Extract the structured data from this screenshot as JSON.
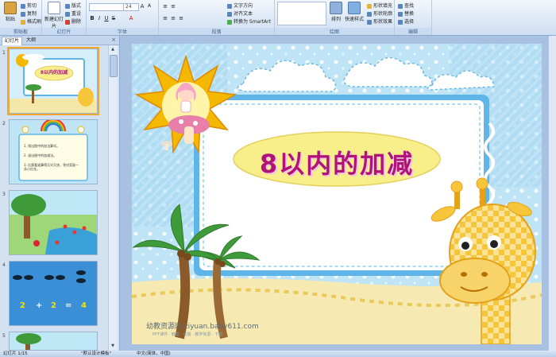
{
  "ribbon": {
    "clipboard": {
      "paste": "粘贴",
      "cut": "剪切",
      "copy": "复制",
      "format_painter": "格式刷",
      "group": "剪贴板"
    },
    "slides": {
      "new_slide": "新建幻灯片",
      "layout": "版式",
      "reset": "重设",
      "delete": "删除",
      "group": "幻灯片"
    },
    "font": {
      "size": "24",
      "group": "字体"
    },
    "paragraph": {
      "text_direction": "文字方向",
      "align_text": "对齐文本",
      "smartart": "转换为 SmartArt",
      "group": "段落"
    },
    "drawing": {
      "arrange": "排列",
      "quick_styles": "快速样式",
      "shape_fill": "形状填充",
      "shape_outline": "形状轮廓",
      "shape_effects": "形状效果",
      "group": "绘图"
    },
    "editing": {
      "find": "查找",
      "replace": "替换",
      "select": "选择",
      "group": "编辑"
    }
  },
  "left_pane": {
    "tabs": [
      "幻灯片",
      "大纲"
    ],
    "close": "×",
    "thumbnails": [
      {
        "number": "1",
        "title": "8以内的加减"
      },
      {
        "number": "2",
        "lines": [
          "1. 找出图中的加法算式。",
          "2. 说出图中的加减法。",
          "3. 比赛看谁算得又对又快，答对奖励一朵小红花。"
        ]
      },
      {
        "number": "3"
      },
      {
        "number": "4",
        "equation": [
          "2",
          "+",
          "2",
          "=",
          "4"
        ]
      },
      {
        "number": "5"
      }
    ]
  },
  "slide": {
    "title": "8以内的加减",
    "watermark_main": "幼教资源网 ziyuan.baby611.com",
    "watermark_sub": "PPT课件 · 教案 · 试题 · 教学资源 · 下载"
  },
  "statusbar": {
    "slide_counter": "幻灯片 1/15",
    "theme": "\"默认设计模板\"",
    "language": "中文(简体，中国)"
  },
  "colors": {
    "title_text": "#b0147a",
    "oval_fill": "#f9ef8a",
    "frame_blue": "#5fb5e8",
    "sun": "#f5b800",
    "giraffe": "#f7c53a"
  }
}
